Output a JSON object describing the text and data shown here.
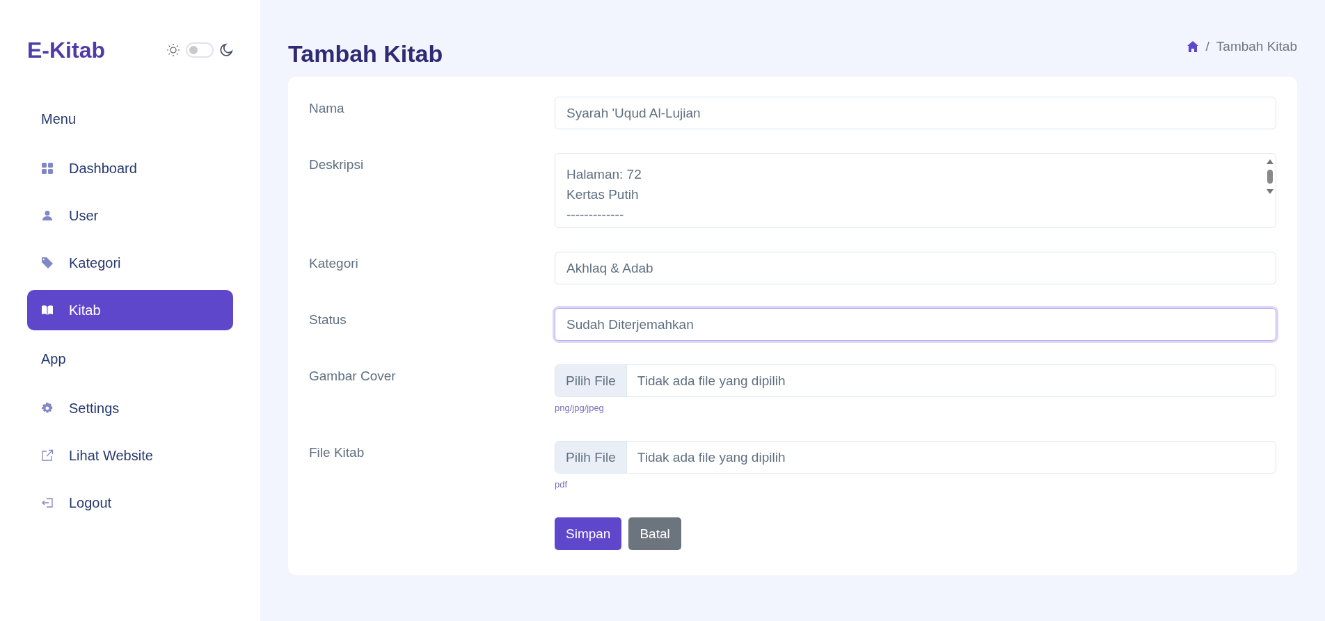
{
  "sidebar": {
    "logo": "E-Kitab",
    "dark_mode": {
      "on": false
    },
    "sections": [
      {
        "heading": "Menu",
        "items": [
          {
            "label": "Dashboard",
            "selected": false
          },
          {
            "label": "User",
            "selected": false
          },
          {
            "label": "Kategori",
            "selected": false
          },
          {
            "label": "Kitab",
            "selected": true
          }
        ]
      },
      {
        "heading": "App",
        "items": [
          {
            "label": "Settings",
            "selected": false
          },
          {
            "label": "Lihat Website",
            "selected": false
          },
          {
            "label": "Logout",
            "selected": false
          }
        ]
      }
    ]
  },
  "page": {
    "title": "Tambah Kitab",
    "separator": "/",
    "breadcrumb": [
      "Tambah Kitab"
    ]
  },
  "form": {
    "fields": [
      {
        "kind": "text",
        "label": "Nama",
        "value": "Syarah 'Uqud Al-Lujian",
        "focused": false
      },
      {
        "kind": "textarea",
        "label": "Deskripsi",
        "lines": [
          "Halaman: 72",
          "Kertas Putih",
          "-------------"
        ]
      },
      {
        "kind": "text",
        "label": "Kategori",
        "value": "Akhlaq & Adab",
        "focused": false
      },
      {
        "kind": "text",
        "label": "Status",
        "value": "Sudah Diterjemahkan",
        "focused": true
      },
      {
        "kind": "file",
        "label": "Gambar Cover",
        "button": "Pilih File",
        "value": "Tidak ada file yang dipilih",
        "hint": "png/jpg/jpeg"
      },
      {
        "kind": "file",
        "label": "File Kitab",
        "button": "Pilih File",
        "value": "Tidak ada file yang dipilih",
        "hint": "pdf"
      }
    ],
    "buttons": [
      {
        "label": "Simpan",
        "kind": "primary"
      },
      {
        "label": "Batal",
        "kind": "secondary"
      }
    ]
  }
}
